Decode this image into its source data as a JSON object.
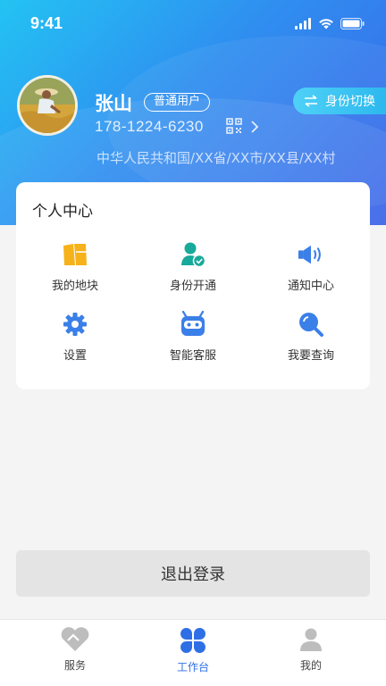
{
  "status_bar": {
    "time": "9:41"
  },
  "profile": {
    "name": "张山",
    "role_badge": "普通用户",
    "phone": "178-1224-6230",
    "address": "中华人民共和国/XX省/XX市/XX县/XX村",
    "switch_identity_label": "身份切换"
  },
  "personal_center": {
    "title": "个人中心",
    "items": [
      {
        "label": "我的地块",
        "icon": "land-plot-icon"
      },
      {
        "label": "身份开通",
        "icon": "user-verify-icon"
      },
      {
        "label": "通知中心",
        "icon": "speaker-icon"
      },
      {
        "label": "设置",
        "icon": "gear-icon"
      },
      {
        "label": "智能客服",
        "icon": "robot-icon"
      },
      {
        "label": "我要查询",
        "icon": "search-icon"
      }
    ]
  },
  "logout_label": "退出登录",
  "tab_bar": {
    "tabs": [
      {
        "label": "服务",
        "icon": "heart-icon",
        "active": false
      },
      {
        "label": "工作台",
        "icon": "clover-icon",
        "active": true
      },
      {
        "label": "我的",
        "icon": "person-icon",
        "active": false
      }
    ]
  },
  "colors": {
    "header_start": "#23c3f3",
    "header_end": "#3b63e8",
    "accent_blue": "#2f6fe6",
    "land_yellow": "#f6b21b",
    "verify_teal": "#17a99a"
  }
}
